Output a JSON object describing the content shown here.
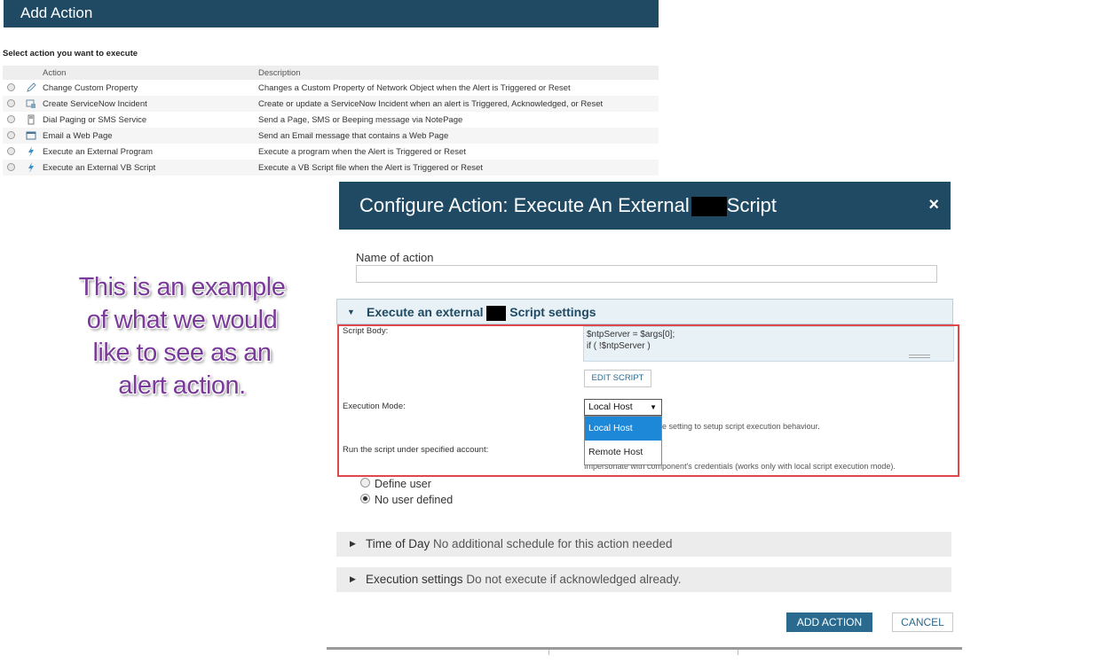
{
  "add_action": {
    "title": "Add Action",
    "select_label": "Select action you want to execute",
    "columns": [
      "Action",
      "Description"
    ],
    "rows": [
      {
        "icon": "pencil-icon",
        "action": "Change Custom Property",
        "description": "Changes a Custom Property of Network Object when the Alert is Triggered or Reset"
      },
      {
        "icon": "servicenow-icon",
        "action": "Create ServiceNow Incident",
        "description": "Create or update a ServiceNow Incident when an alert is Triggered, Acknowledged, or Reset"
      },
      {
        "icon": "pager-icon",
        "action": "Dial Paging or SMS Service",
        "description": "Send a Page, SMS or Beeping message via NotePage"
      },
      {
        "icon": "webpage-icon",
        "action": "Email a Web Page",
        "description": "Send an Email message that contains a Web Page"
      },
      {
        "icon": "lightning-icon",
        "action": "Execute an External Program",
        "description": "Execute a program when the Alert is Triggered or Reset"
      },
      {
        "icon": "lightning-icon",
        "action": "Execute an External VB Script",
        "description": "Execute a VB Script file when the Alert is Triggered or Reset"
      }
    ]
  },
  "annotation": {
    "text": "This is an example of what we would like to see as an alert action."
  },
  "configure": {
    "title_prefix": "Configure Action: Execute An External",
    "title_suffix": "Script",
    "close": "×",
    "name_label": "Name of action",
    "name_value": "",
    "section_prefix": "Execute an external",
    "section_suffix": "Script settings",
    "script_body_label": "Script Body:",
    "script_lines": [
      "$ntpServer = $args[0];",
      "if ( !$ntpServer )"
    ],
    "edit_script": "EDIT SCRIPT",
    "execution_mode_label": "Execution Mode:",
    "execution_mode_value": "Local Host",
    "execution_mode_options": [
      "Local Host",
      "Remote Host"
    ],
    "execution_hint": "e setting to setup script execution behaviour.",
    "run_account_label": "Run the script under specified account:",
    "impersonate_hint": "Impersonate with component's credentials (works only with local script execution mode).",
    "radio_define_user": "Define user",
    "radio_no_user": "No user defined",
    "radio_selected": "No user defined",
    "time_of_day_title": "Time of Day",
    "time_of_day_desc": "No additional schedule for this action needed",
    "execution_settings_title": "Execution settings",
    "execution_settings_desc": "Do not execute if acknowledged already.",
    "add_action_button": "ADD ACTION",
    "cancel_button": "CANCEL"
  },
  "colors": {
    "header_bg": "#204a63",
    "primary_button": "#2a6a8e",
    "highlight_border": "#e0474c",
    "dropdown_selected": "#1e88d8",
    "annotation_text": "#7a3a9a"
  }
}
